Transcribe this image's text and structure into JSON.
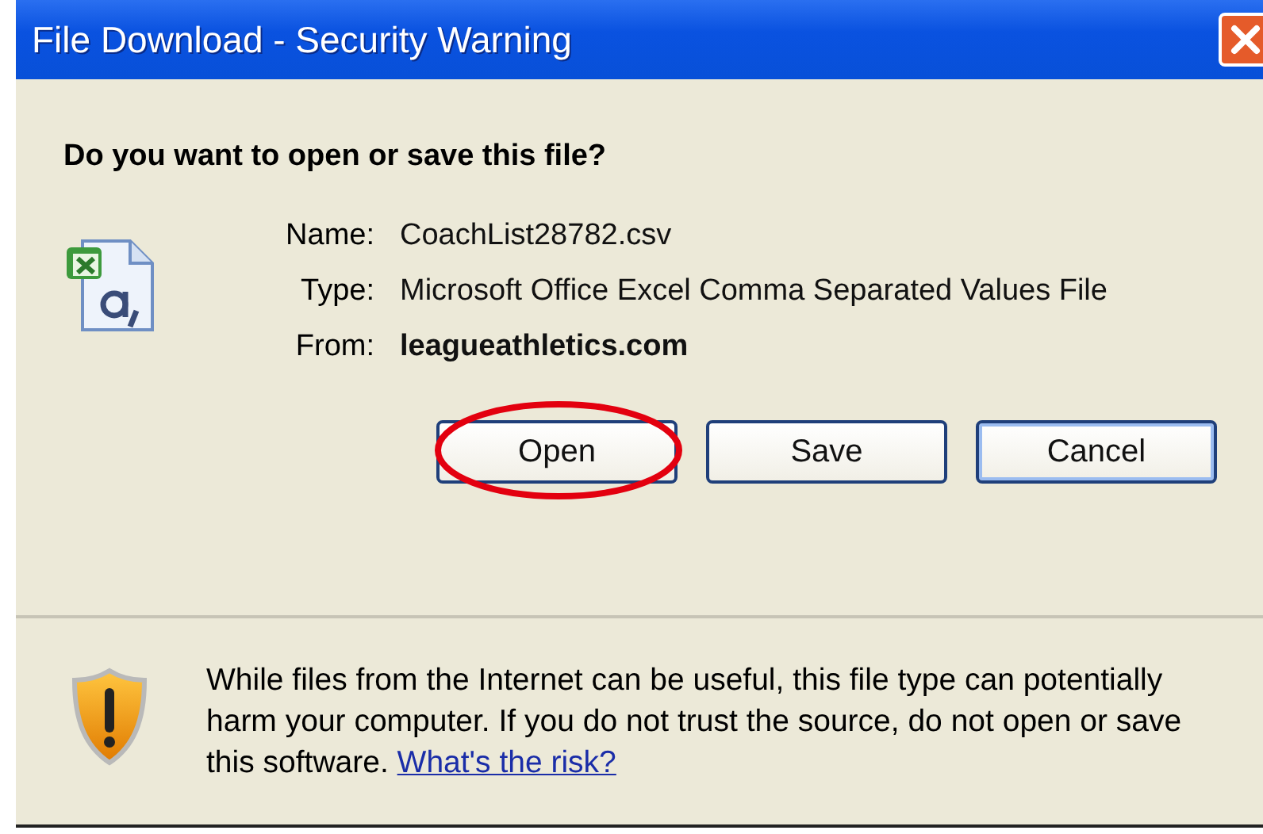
{
  "window": {
    "title": "File Download - Security Warning"
  },
  "question": "Do you want to open or save this file?",
  "file_info": [
    {
      "label": "Name:",
      "value": "CoachList28782.csv",
      "bold": false
    },
    {
      "label": "Type:",
      "value": "Microsoft Office Excel Comma Separated Values File",
      "bold": false
    },
    {
      "label": "From:",
      "value": "leagueathletics.com",
      "bold": true
    }
  ],
  "buttons": [
    {
      "label": "Open",
      "default": false,
      "circled": true
    },
    {
      "label": "Save",
      "default": false,
      "circled": false
    },
    {
      "label": "Cancel",
      "default": true,
      "circled": false
    }
  ],
  "warning": {
    "text": "While files from the Internet can be useful, this file type can potentially harm your computer. If you do not trust the source, do not open or save this software.",
    "link": "What's the risk?"
  }
}
